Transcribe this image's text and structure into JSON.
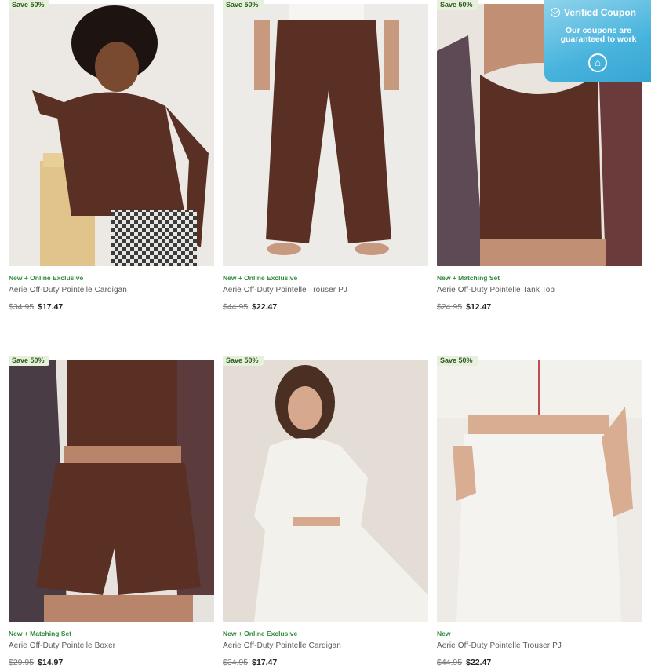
{
  "coupon": {
    "title": "Verified Coupon",
    "subtitle": "Our coupons are guaranteed to work",
    "logo_glyph": "⌂",
    "icon": "check-badge-icon"
  },
  "products": [
    {
      "badge": "Save 50%",
      "tag": "New + Online Exclusive",
      "name": "Aerie Off-Duty Pointelle Cardigan",
      "original_price": "$34.95",
      "sale_price": "$17.47",
      "garment_color": "#5a2f24"
    },
    {
      "badge": "Save 50%",
      "tag": "New + Online Exclusive",
      "name": "Aerie Off-Duty Pointelle Trouser PJ",
      "original_price": "$44.95",
      "sale_price": "$22.47",
      "garment_color": "#5a2f24"
    },
    {
      "badge": "Save 50%",
      "tag": "New + Matching Set",
      "name": "Aerie Off-Duty Pointelle Tank Top",
      "original_price": "$24.95",
      "sale_price": "$12.47",
      "garment_color": "#5a2f24"
    },
    {
      "badge": "Save 50%",
      "tag": "New + Matching Set",
      "name": "Aerie Off-Duty Pointelle Boxer",
      "original_price": "$29.95",
      "sale_price": "$14.97",
      "garment_color": "#5a2f24"
    },
    {
      "badge": "Save 50%",
      "tag": "New + Online Exclusive",
      "name": "Aerie Off-Duty Pointelle Cardigan",
      "original_price": "$34.95",
      "sale_price": "$17.47",
      "garment_color": "#f3f1ec"
    },
    {
      "badge": "Save 50%",
      "tag": "New",
      "name": "Aerie Off-Duty Pointelle Trouser PJ",
      "original_price": "$44.95",
      "sale_price": "$22.47",
      "garment_color": "#f3f1ec"
    }
  ]
}
